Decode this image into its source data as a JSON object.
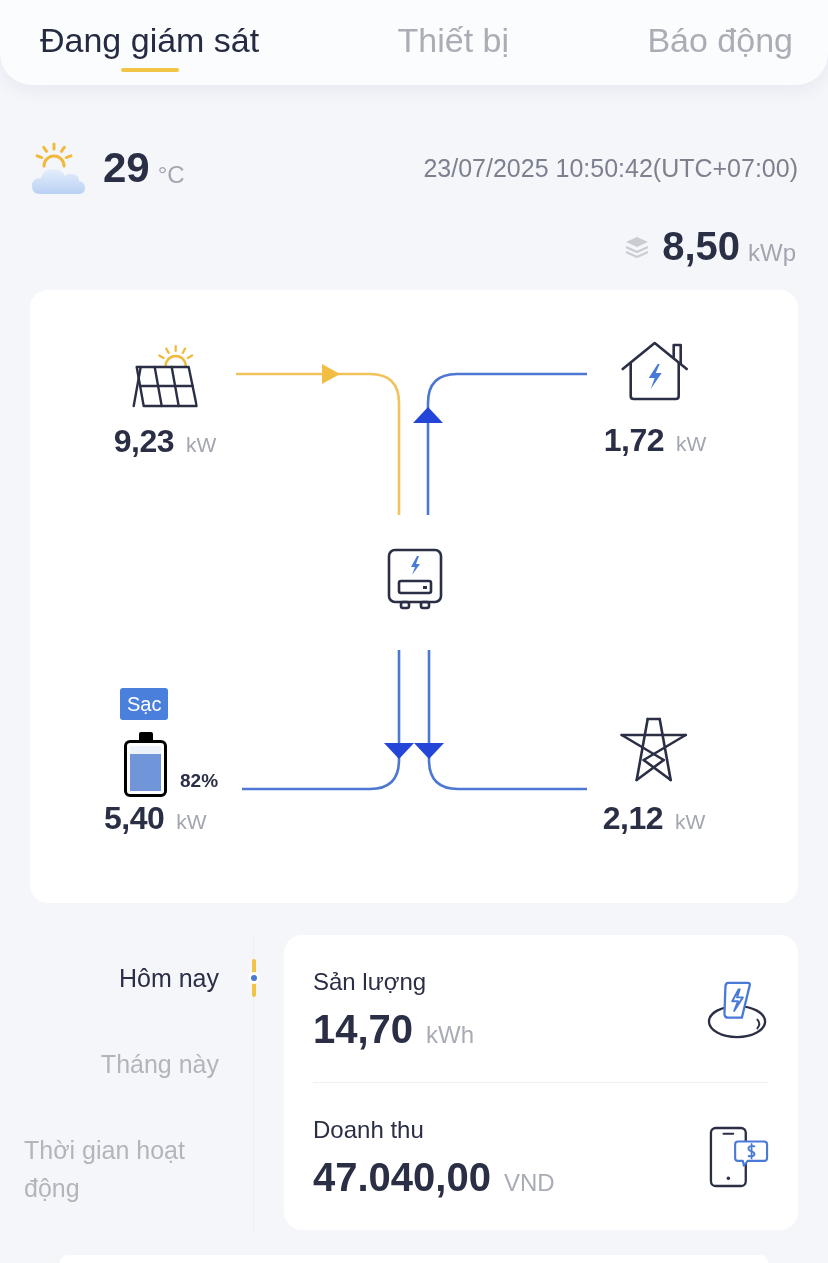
{
  "tabs": [
    {
      "label": "Đang giám sát",
      "selected": true
    },
    {
      "label": "Thiết bị",
      "selected": false
    },
    {
      "label": "Báo động",
      "selected": false
    }
  ],
  "weather": {
    "temperature": "29",
    "unit": "°C",
    "datetime": "23/07/2025 10:50:42(UTC+07:00)"
  },
  "capacity": {
    "value": "8,50",
    "unit": "kWp"
  },
  "flow": {
    "nodes": [
      {
        "kind": "solar",
        "toward_inverter": true,
        "value": "9,23",
        "unit": "kW"
      },
      {
        "kind": "home",
        "toward_inverter": false,
        "value": "1,72",
        "unit": "kW"
      },
      {
        "kind": "battery",
        "toward_inverter": false,
        "badge": "Sạc",
        "level": 0.82,
        "percent": "82%",
        "value": "5,40",
        "unit": "kW"
      },
      {
        "kind": "grid",
        "toward_inverter": false,
        "value": "2,12",
        "unit": "kW"
      }
    ]
  },
  "periods": [
    {
      "label": "Hôm nay",
      "selected": true
    },
    {
      "label": "Tháng này",
      "selected": false
    },
    {
      "label": "Thời gian hoạt động",
      "selected": false
    }
  ],
  "stats": [
    {
      "kind": "energy",
      "label": "Sản lượng",
      "value": "14,70",
      "unit": "kWh"
    },
    {
      "kind": "revenue",
      "label": "Doanh thu",
      "value": "47.040,00",
      "unit": "VND"
    }
  ]
}
